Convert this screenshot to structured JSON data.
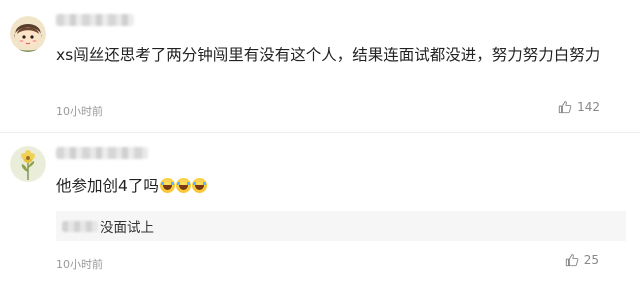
{
  "comments": [
    {
      "text": "xs闯丝还思考了两分钟闯里有没有这个人，结果连面试都没进，努力努力白努力",
      "time": "10小时前",
      "likes": "142",
      "avatar_icon": "cartoon-girl-avatar",
      "like_icon": "thumbs-up-icon"
    },
    {
      "text": "他参加创4了吗",
      "emoji_icon": "laughing-tears-emoji",
      "emoji_count": 3,
      "reply_text": "没面试上",
      "time": "10小时前",
      "likes": "25",
      "avatar_icon": "flower-sketch-avatar",
      "like_icon": "thumbs-up-icon"
    }
  ]
}
